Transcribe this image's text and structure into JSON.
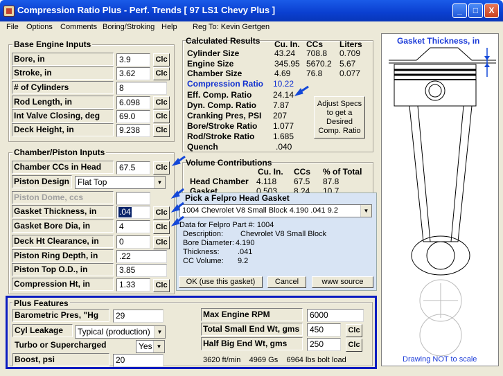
{
  "window": {
    "title": "Compression Ratio Plus - Perf. Trends  [ 97 LS1 Chevy Plus ]",
    "min": "_",
    "max": "□",
    "close": "X"
  },
  "menu": [
    "File",
    "Options",
    "Comments",
    "Boring/Stroking",
    "Help"
  ],
  "reg": "Reg To: Kevin Gertgen",
  "base": {
    "title": "Base Engine Inputs",
    "rows": [
      {
        "label": "Bore, in",
        "value": "3.9",
        "clc": "Clc"
      },
      {
        "label": "Stroke, in",
        "value": "3.62",
        "clc": "Clc"
      },
      {
        "label": "# of Cylinders",
        "value": "8"
      },
      {
        "label": "Rod Length, in",
        "value": "6.098",
        "clc": "Clc"
      },
      {
        "label": "Int Valve Closing, deg",
        "value": "69.0",
        "clc": "Clc"
      },
      {
        "label": "Deck Height, in",
        "value": "9.238",
        "clc": "Clc"
      }
    ]
  },
  "chamber": {
    "title": "Chamber/Piston Inputs",
    "rows": [
      {
        "label": "Chamber CCs in Head",
        "value": "67.5",
        "clc": "Clc"
      },
      {
        "label": "Piston Design",
        "value": "Flat Top"
      },
      {
        "label": "Piston Dome, ccs",
        "value": ""
      },
      {
        "label": "Gasket Thickness, in",
        "value": ".04",
        "clc": "Clc"
      },
      {
        "label": "Gasket Bore Dia, in",
        "value": "4",
        "clc": "Clc"
      },
      {
        "label": "Deck Ht Clearance, in",
        "value": "0",
        "clc": "Clc"
      },
      {
        "label": "Piston Ring Depth, in",
        "value": ".22"
      },
      {
        "label": "Piston Top O.D., in",
        "value": "3.85"
      },
      {
        "label": "Compression Ht, in",
        "value": "1.33",
        "clc": "Clc"
      }
    ]
  },
  "calc": {
    "title": "Calculated Results",
    "h1": "Cu. In.",
    "h2": "CCs",
    "h3": "Liters",
    "rows": [
      {
        "label": "Cylinder Size",
        "a": "43.24",
        "b": "708.8",
        "c": "0.709"
      },
      {
        "label": "Engine Size",
        "a": "345.95",
        "b": "5670.2",
        "c": "5.67"
      },
      {
        "label": "Chamber Size",
        "a": "4.69",
        "b": "76.8",
        "c": "0.077"
      }
    ],
    "cr_label": "Compression Ratio",
    "cr": "10.22",
    "rows2": [
      {
        "label": "Eff. Comp. Ratio",
        "v": "24.14"
      },
      {
        "label": "Dyn. Comp. Ratio",
        "v": "7.87"
      },
      {
        "label": "Cranking Pres, PSI",
        "v": "207"
      },
      {
        "label": "Bore/Stroke Ratio",
        "v": "1.077"
      },
      {
        "label": "Rod/Stroke Ratio",
        "v": "1.685"
      },
      {
        "label": "Quench",
        "v": ".040"
      }
    ],
    "adjust": "Adjust Specs to get a Desired Comp. Ratio"
  },
  "volume": {
    "title": "Volume Contributions",
    "h1": "Cu. In.",
    "h2": "CCs",
    "h3": "% of Total",
    "rows": [
      {
        "label": "Head Chamber",
        "a": "4.118",
        "b": "67.5",
        "c": "87.8"
      },
      {
        "label": "Gasket",
        "a": "0.503",
        "b": "8.24",
        "c": "10.7"
      }
    ]
  },
  "popup": {
    "title": "Pick a Felpro Head Gasket",
    "selected": "1004 Chevrolet V8 Small Block 4.190 .041 9.2",
    "data_title": "Data for Felpro Part #:  1004",
    "desc_label": "Description:",
    "desc": "Chevrolet V8 Small Block",
    "bore_label": "Bore Diameter:",
    "bore": "4.190",
    "thick_label": "Thickness:",
    "thick": ".041",
    "cc_label": "CC Volume:",
    "cc": "9.2",
    "ok": "OK (use this gasket)",
    "cancel": "Cancel",
    "www": "www  source"
  },
  "diagram": {
    "title": "Gasket Thickness, in",
    "note": "Drawing NOT to scale"
  },
  "plus": {
    "title": "Plus Features",
    "baro_label": "Barometric Pres, \"Hg",
    "baro": "29",
    "leak_label": "Cyl Leakage",
    "leak": "Typical (production)",
    "turbo_label": "Turbo or Supercharged",
    "turbo": "Yes",
    "boost_label": "Boost, psi",
    "boost": "20",
    "rpm_label": "Max Engine RPM",
    "rpm": "6000",
    "small_label": "Total Small End Wt, gms",
    "small": "450",
    "big_label": "Half Big End Wt, gms",
    "big": "250",
    "clc": "Clc",
    "stats": "3620 ft/min    4969 Gs    6964 lbs bolt load"
  }
}
